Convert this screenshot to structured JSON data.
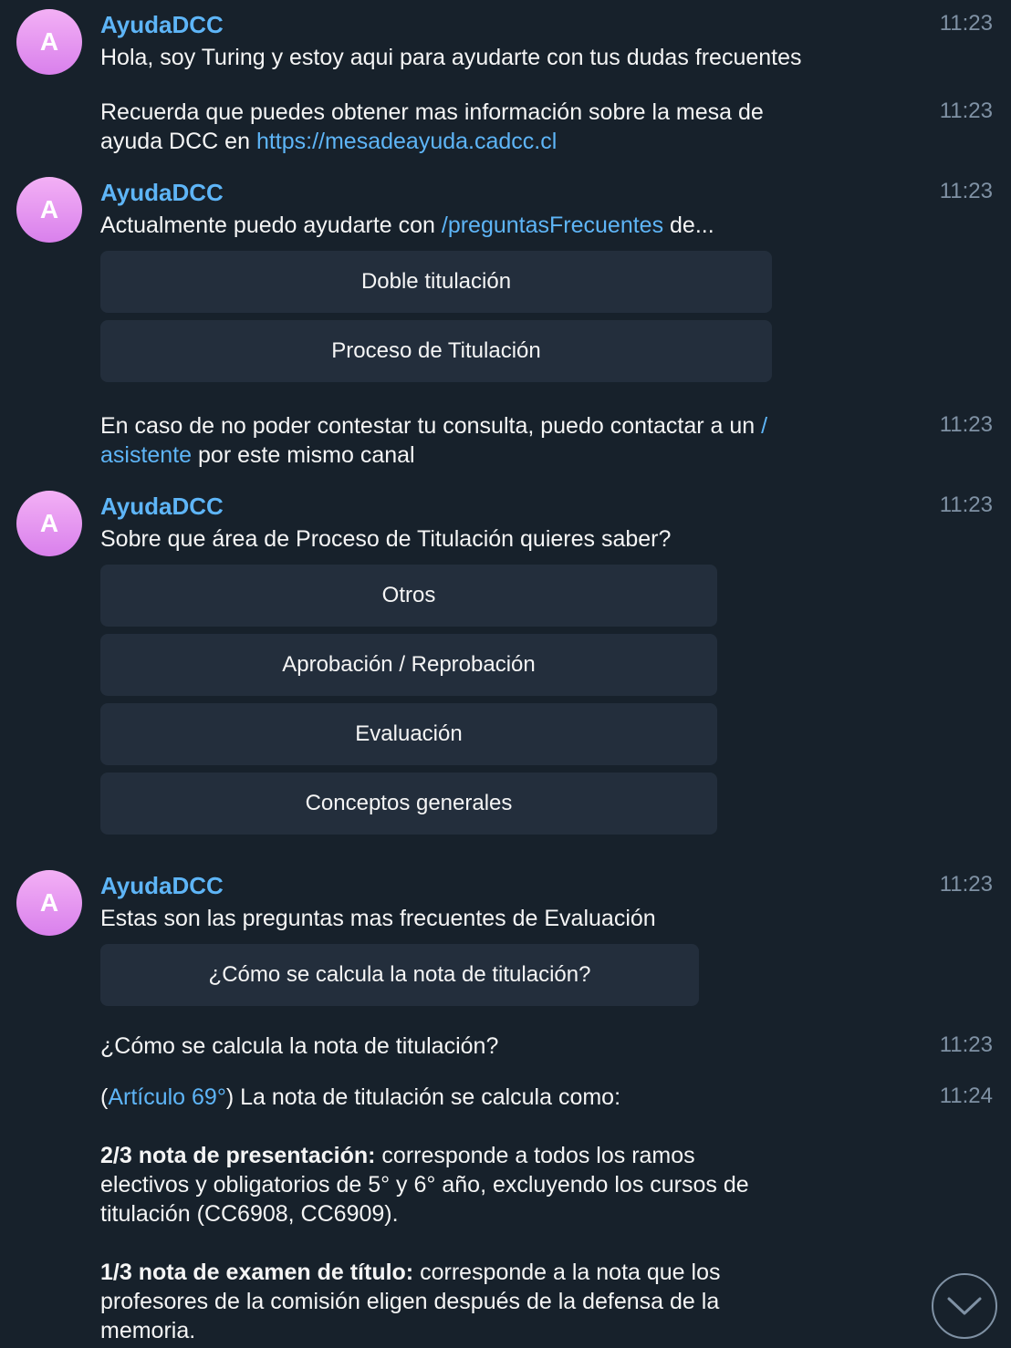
{
  "bot": {
    "name": "AyudaDCC",
    "avatar_letter": "A"
  },
  "colors": {
    "background": "#17212b",
    "accent": "#5eb5f7",
    "button": "#232e3c",
    "avatar": "#e79cf0"
  },
  "messages": {
    "m1": {
      "text": "Hola, soy Turing y estoy aqui para ayudarte con tus dudas frecuentes",
      "time": "11:23"
    },
    "m2": {
      "line1": "Recuerda que puedes obtener mas información sobre la mesa de",
      "line2_prefix": "ayuda DCC en ",
      "link": "https://mesadeayuda.cadcc.cl",
      "time": "11:23"
    },
    "m3": {
      "prefix": "Actualmente puedo ayudarte con ",
      "link": "/preguntasFrecuentes",
      "suffix": " de...",
      "time": "11:23",
      "buttons": [
        "Doble titulación",
        "Proceso de Titulación"
      ]
    },
    "m4": {
      "prefix": "En caso de no poder contestar tu consulta, puedo contactar a un ",
      "link1": "/",
      "link2": "asistente",
      "suffix": " por este mismo canal",
      "time": "11:23"
    },
    "m5": {
      "text": "Sobre que área de Proceso de Titulación quieres saber?",
      "time": "11:23",
      "buttons": [
        "Otros",
        "Aprobación / Reprobación",
        "Evaluación",
        "Conceptos generales"
      ]
    },
    "m6": {
      "text": "Estas son las preguntas mas frecuentes de Evaluación",
      "time": "11:23",
      "buttons": [
        "¿Cómo se calcula la nota de titulación?"
      ]
    },
    "m7": {
      "text": "¿Cómo se calcula la nota de titulación?",
      "time": "11:23"
    },
    "m8": {
      "open": "(",
      "link": "Artículo 69°",
      "rest": ") La nota de titulación se calcula como:",
      "p1_bold": "2/3 nota de presentación:",
      "p1_l1": " corresponde a todos los ramos",
      "p1_l2": "electivos y obligatorios de 5° y 6° año, excluyendo los cursos de",
      "p1_l3": "titulación (CC6908, CC6909).",
      "p2_bold": "1/3 nota de examen de título:",
      "p2_l1": " corresponde a la nota que los",
      "p2_l2": "profesores de la comisión eligen después de la defensa de la",
      "p2_l3": "memoria.",
      "time": "11:24"
    }
  },
  "scroll_button": {
    "icon": "chevron-down-icon"
  }
}
